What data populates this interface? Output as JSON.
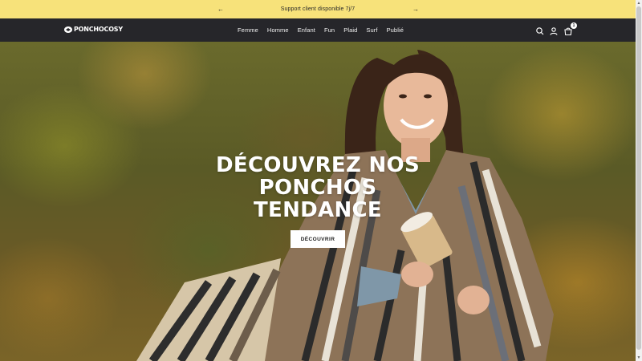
{
  "announcement": {
    "text": "Support client disponible 7j/7",
    "prev_icon": "arrow-left-icon",
    "next_icon": "arrow-right-icon"
  },
  "header": {
    "logo_text": "PONCHOCOSY",
    "nav": [
      "Femme",
      "Homme",
      "Enfant",
      "Fun",
      "Plaid",
      "Surf",
      "Publié"
    ],
    "icons": [
      "search-icon",
      "account-icon",
      "cart-icon"
    ],
    "cart_count": "1"
  },
  "hero": {
    "title_lines": [
      "DÉCOUVREZ NOS",
      "PONCHOS",
      "TENDANCE"
    ],
    "button_label": "DÉCOUVRIR"
  },
  "colors": {
    "announcement_bg": "#f7e27a",
    "header_bg": "#26262a",
    "button_bg": "#ffffff"
  }
}
